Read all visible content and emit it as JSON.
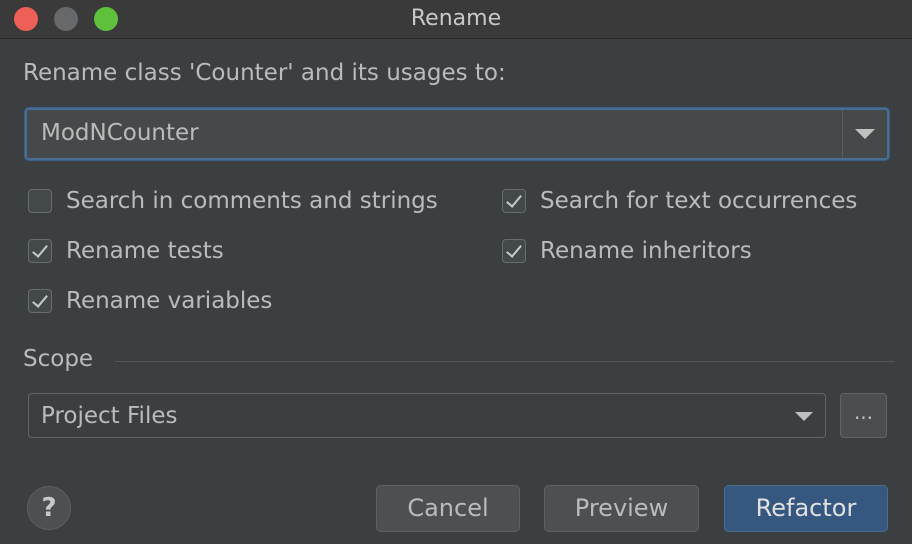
{
  "window": {
    "title": "Rename"
  },
  "dialog": {
    "prompt": "Rename class 'Counter' and its usages to:",
    "name_value": "ModNCounter"
  },
  "options": [
    {
      "label": "Search in comments and strings",
      "checked": false
    },
    {
      "label": "Search for text occurrences",
      "checked": true
    },
    {
      "label": "Rename tests",
      "checked": true
    },
    {
      "label": "Rename inheritors",
      "checked": true
    },
    {
      "label": "Rename variables",
      "checked": true
    }
  ],
  "scope": {
    "label": "Scope",
    "selected": "Project Files",
    "browse_label": "..."
  },
  "buttons": {
    "help": "?",
    "cancel": "Cancel",
    "preview": "Preview",
    "refactor": "Refactor"
  },
  "colors": {
    "background": "#3c3f41",
    "focus_border": "#466d94",
    "primary_button": "#365880",
    "close_light": "#ee5f57",
    "maximize_light": "#5fc13b"
  }
}
